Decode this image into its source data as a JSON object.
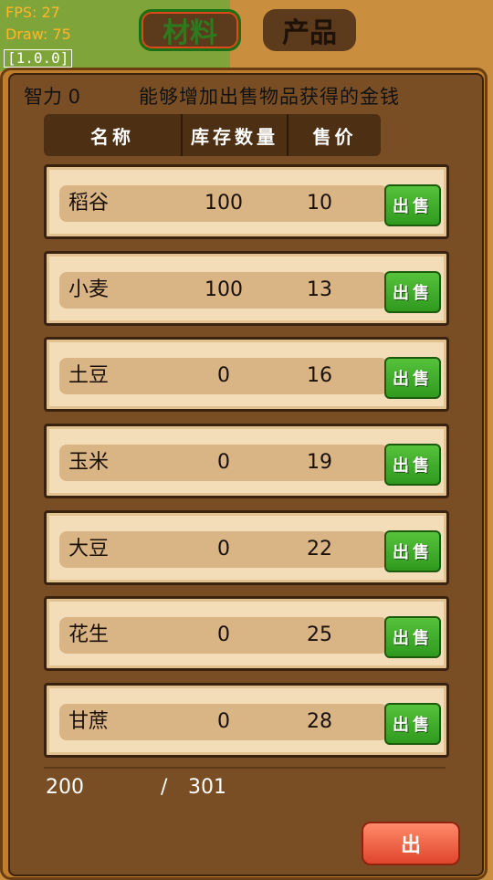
{
  "debug": {
    "fps": "FPS: 27",
    "draw": "Draw: 75",
    "version": "[1.0.0]"
  },
  "tabs": {
    "materials": "材料",
    "products": "产品"
  },
  "panel": {
    "intelligence": "智力 0",
    "description": "能够增加出售物品获得的金钱"
  },
  "table": {
    "headers": [
      "名称",
      "库存数量",
      "售价"
    ],
    "rows": [
      {
        "name": "稻谷",
        "stock": "100",
        "price": "10",
        "button": "出售"
      },
      {
        "name": "小麦",
        "stock": "100",
        "price": "13",
        "button": "出售"
      },
      {
        "name": "土豆",
        "stock": "0",
        "price": "16",
        "button": "出售"
      },
      {
        "name": "玉米",
        "stock": "0",
        "price": "19",
        "button": "出售"
      },
      {
        "name": "大豆",
        "stock": "0",
        "price": "22",
        "button": "出售"
      },
      {
        "name": "花生",
        "stock": "0",
        "price": "25",
        "button": "出售"
      },
      {
        "name": "甘蔗",
        "stock": "0",
        "price": "28",
        "button": "出售"
      }
    ]
  },
  "capacity": {
    "current": "200",
    "separator": "/",
    "max": "301"
  },
  "sell_all": "出",
  "colors": {
    "sell_button": "#3fae2a",
    "panel": "#7a4e24",
    "row": "#f3ddb8"
  }
}
